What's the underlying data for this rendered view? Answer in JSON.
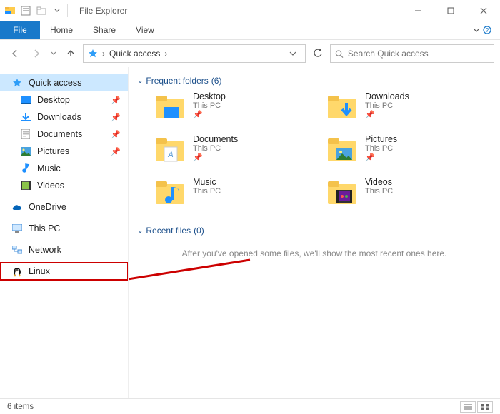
{
  "title": "File Explorer",
  "ribbon": {
    "file": "File",
    "tabs": [
      "Home",
      "Share",
      "View"
    ]
  },
  "address": {
    "location": "Quick access"
  },
  "search": {
    "placeholder": "Search Quick access"
  },
  "nav": {
    "quick_access": "Quick access",
    "pinned": [
      {
        "label": "Desktop"
      },
      {
        "label": "Downloads"
      },
      {
        "label": "Documents"
      },
      {
        "label": "Pictures"
      }
    ],
    "items": [
      {
        "label": "Music"
      },
      {
        "label": "Videos"
      }
    ],
    "roots": [
      {
        "label": "OneDrive"
      },
      {
        "label": "This PC"
      },
      {
        "label": "Network"
      },
      {
        "label": "Linux"
      }
    ]
  },
  "sections": {
    "frequent": {
      "title": "Frequent folders",
      "count": 6
    },
    "recent": {
      "title": "Recent files",
      "count": 0,
      "empty": "After you've opened some files, we'll show the most recent ones here."
    }
  },
  "folders": [
    {
      "name": "Desktop",
      "loc": "This PC",
      "pinned": true
    },
    {
      "name": "Downloads",
      "loc": "This PC",
      "pinned": true
    },
    {
      "name": "Documents",
      "loc": "This PC",
      "pinned": true
    },
    {
      "name": "Pictures",
      "loc": "This PC",
      "pinned": true
    },
    {
      "name": "Music",
      "loc": "This PC",
      "pinned": false
    },
    {
      "name": "Videos",
      "loc": "This PC",
      "pinned": false
    }
  ],
  "status": {
    "text": "6 items"
  }
}
